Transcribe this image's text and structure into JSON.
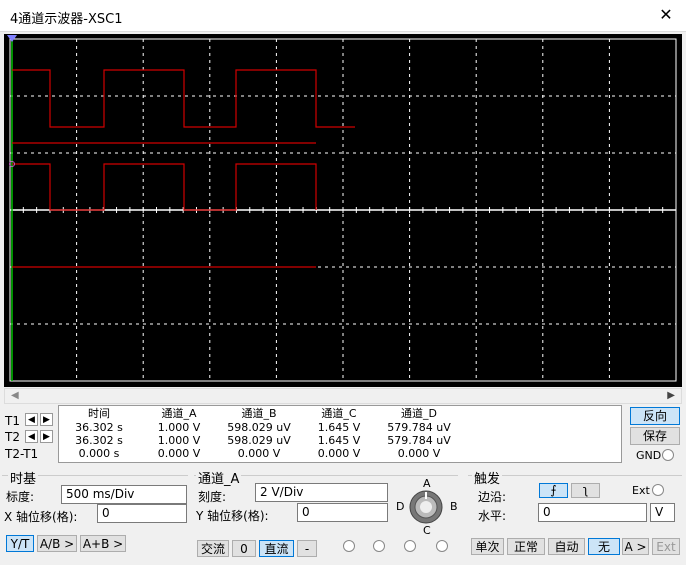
{
  "window": {
    "title": "4通道示波器-XSC1"
  },
  "measure": {
    "cursors": [
      "T1",
      "T2",
      "T2-T1"
    ],
    "headers": [
      "时间",
      "通道_A",
      "通道_B",
      "通道_C",
      "通道_D"
    ],
    "rows": [
      [
        "36.302 s",
        "1.000 V",
        "598.029 uV",
        "1.645 V",
        "579.784 uV"
      ],
      [
        "36.302 s",
        "1.000 V",
        "598.029 uV",
        "1.645 V",
        "579.784 uV"
      ],
      [
        "0.000 s",
        "0.000 V",
        "0.000 V",
        "0.000 V",
        "0.000 V"
      ]
    ]
  },
  "side": {
    "reverse": "反向",
    "save": "保存",
    "gnd": "GND"
  },
  "timebase": {
    "title": "时基",
    "scale_label": "标度:",
    "scale_value": "500 ms/Div",
    "xpos_label": "X 轴位移(格):",
    "xpos_value": "0",
    "btn_yt": "Y/T",
    "btn_ab": "A/B >",
    "btn_apb": "A+B >"
  },
  "channel": {
    "title": "通道_A",
    "scale_label": "刻度:",
    "scale_value": "2  V/Div",
    "ypos_label": "Y 轴位移(格):",
    "ypos_value": "0",
    "btn_ac": "交流",
    "btn_zero": "0",
    "btn_dc": "直流",
    "btn_minus": "-",
    "knob_labels": {
      "a": "A",
      "b": "B",
      "c": "C",
      "d": "D"
    }
  },
  "trigger": {
    "title": "触发",
    "edge_label": "边沿:",
    "ext_label": "Ext",
    "level_label": "水平:",
    "level_value": "0",
    "level_unit": "V",
    "btn_single": "单次",
    "btn_normal": "正常",
    "btn_auto": "自动",
    "btn_none": "无",
    "btn_a": "A >",
    "btn_ext": "Ext"
  },
  "colors": {
    "trace": "#d00000",
    "grid": "#ffffff",
    "screen": "#000000",
    "cursor": "#00c000"
  }
}
